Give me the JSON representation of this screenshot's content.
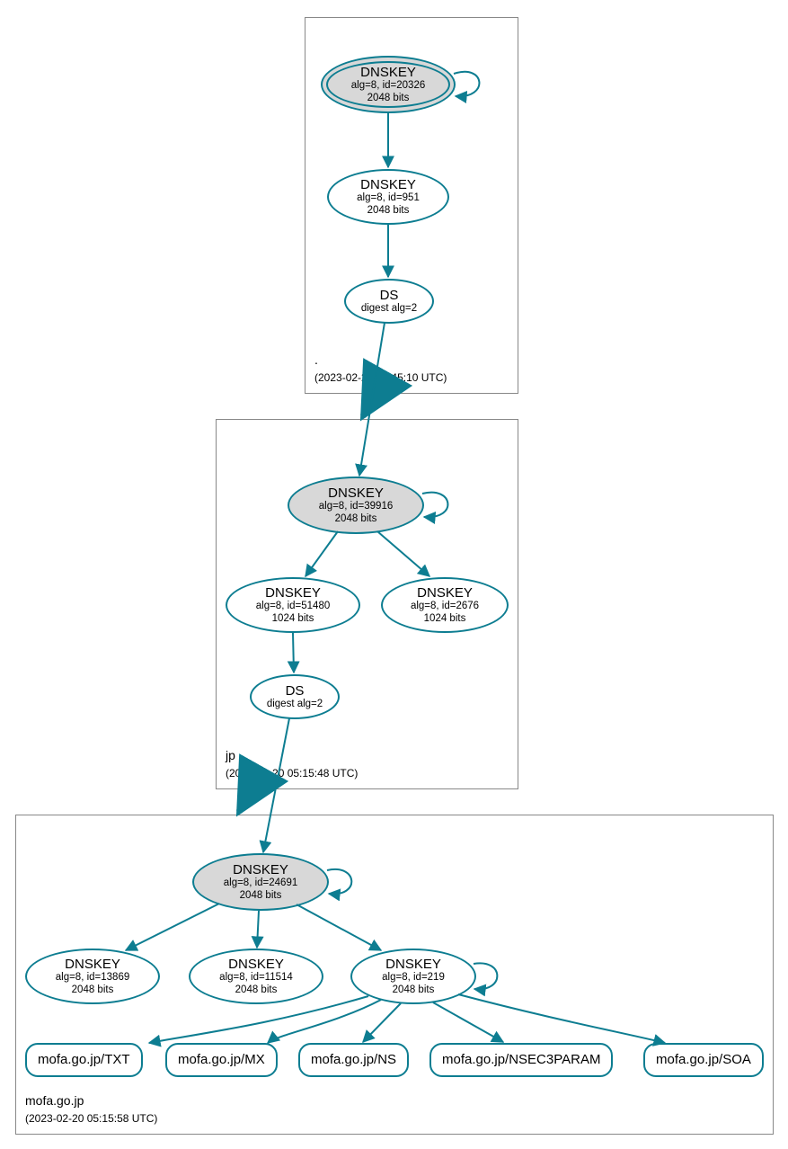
{
  "colors": {
    "stroke": "#0d7d91",
    "ksk_fill": "#d8d8d8"
  },
  "zones": {
    "root": {
      "name": ".",
      "timestamp": "(2023-02-20 03:45:10 UTC)"
    },
    "jp": {
      "name": "jp",
      "timestamp": "(2023-02-20 05:15:48 UTC)"
    },
    "mofa": {
      "name": "mofa.go.jp",
      "timestamp": "(2023-02-20 05:15:58 UTC)"
    }
  },
  "nodes": {
    "root_ksk": {
      "title": "DNSKEY",
      "line2": "alg=8, id=20326",
      "line3": "2048 bits"
    },
    "root_zsk": {
      "title": "DNSKEY",
      "line2": "alg=8, id=951",
      "line3": "2048 bits"
    },
    "root_ds": {
      "title": "DS",
      "line2": "digest alg=2"
    },
    "jp_ksk": {
      "title": "DNSKEY",
      "line2": "alg=8, id=39916",
      "line3": "2048 bits"
    },
    "jp_zsk1": {
      "title": "DNSKEY",
      "line2": "alg=8, id=51480",
      "line3": "1024 bits"
    },
    "jp_zsk2": {
      "title": "DNSKEY",
      "line2": "alg=8, id=2676",
      "line3": "1024 bits"
    },
    "jp_ds": {
      "title": "DS",
      "line2": "digest alg=2"
    },
    "mofa_ksk": {
      "title": "DNSKEY",
      "line2": "alg=8, id=24691",
      "line3": "2048 bits"
    },
    "mofa_z1": {
      "title": "DNSKEY",
      "line2": "alg=8, id=13869",
      "line3": "2048 bits"
    },
    "mofa_z2": {
      "title": "DNSKEY",
      "line2": "alg=8, id=11514",
      "line3": "2048 bits"
    },
    "mofa_z3": {
      "title": "DNSKEY",
      "line2": "alg=8, id=219",
      "line3": "2048 bits"
    }
  },
  "records": {
    "txt": "mofa.go.jp/TXT",
    "mx": "mofa.go.jp/MX",
    "ns": "mofa.go.jp/NS",
    "nsec3": "mofa.go.jp/NSEC3PARAM",
    "soa": "mofa.go.jp/SOA"
  }
}
